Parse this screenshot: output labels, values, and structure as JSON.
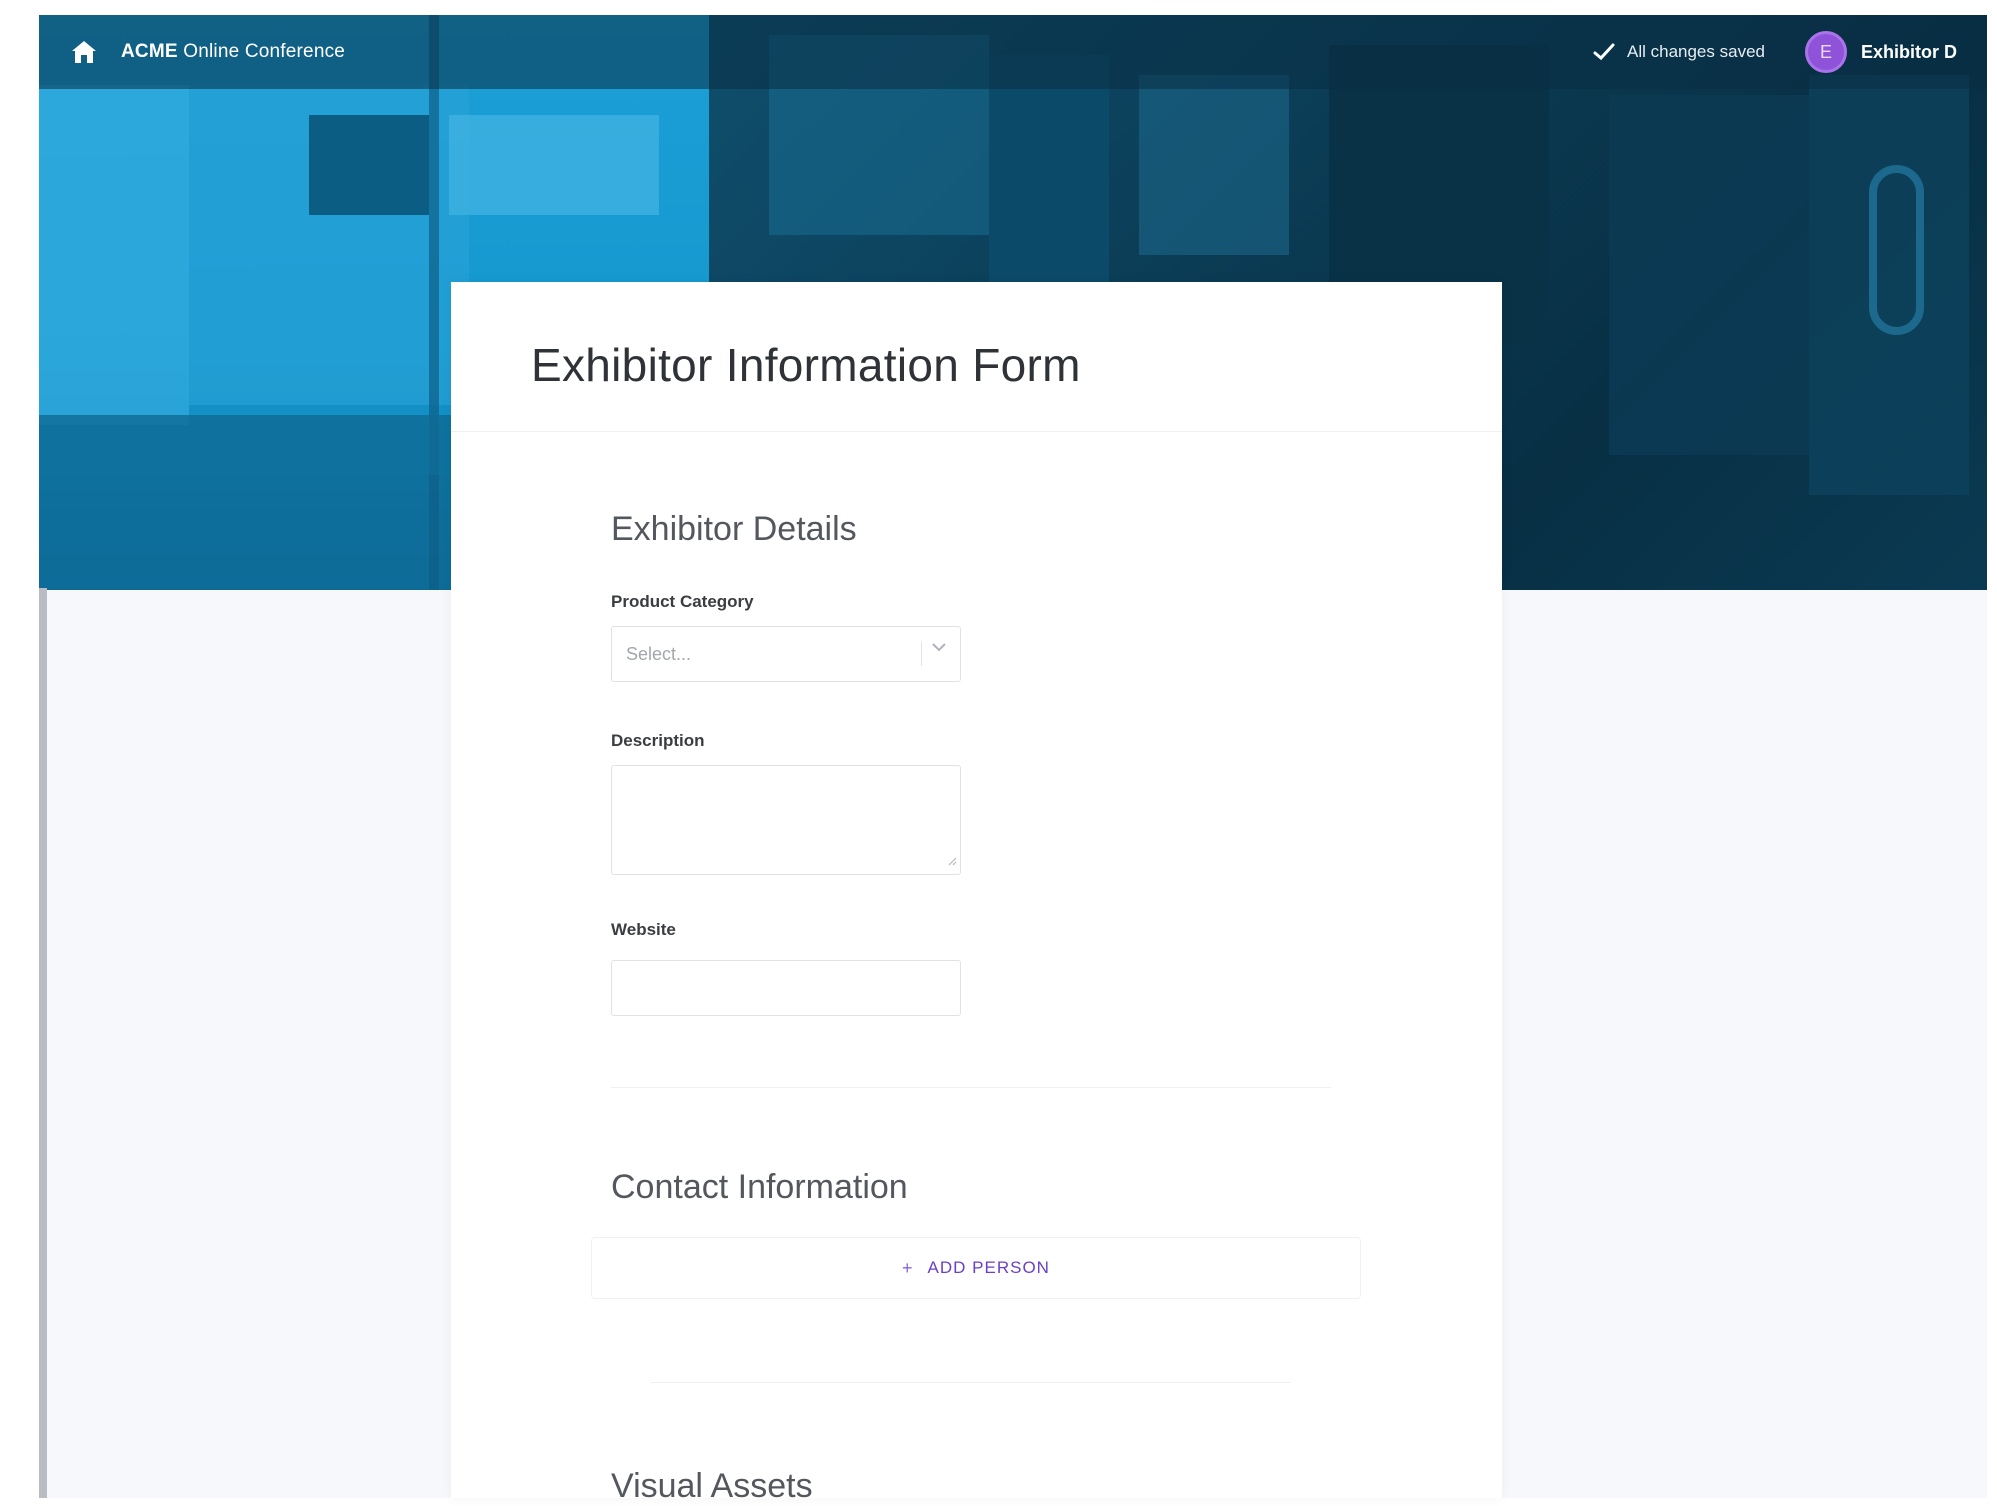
{
  "topbar": {
    "brand_bold": "ACME",
    "brand_rest": " Online Conference",
    "saved_status": "All changes saved",
    "avatar_initial": "E",
    "user_name": "Exhibitor D"
  },
  "form": {
    "title": "Exhibitor Information Form",
    "sections": {
      "details": {
        "title": "Exhibitor Details",
        "product_category_label": "Product Category",
        "product_category_placeholder": "Select...",
        "description_label": "Description",
        "website_label": "Website"
      },
      "contact": {
        "title": "Contact Information",
        "add_person_label": "ADD PERSON"
      },
      "visual": {
        "title": "Visual Assets"
      }
    }
  },
  "colors": {
    "accent": "#6a3fc9",
    "avatar": "#8e53d9",
    "hero_blue": "#1599cf"
  },
  "icons": {
    "home": "home-icon",
    "check": "check-icon",
    "chevron": "chevron-down-icon",
    "plus": "plus-icon"
  }
}
